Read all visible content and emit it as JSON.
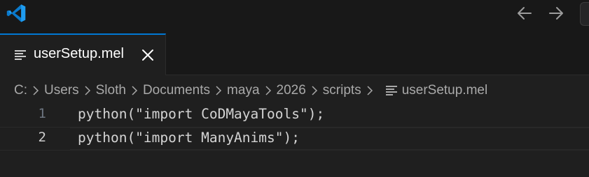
{
  "window": {
    "app_icon": "vscode-logo",
    "nav_back_icon": "arrow-left-icon",
    "nav_forward_icon": "arrow-right-icon"
  },
  "tab": {
    "label": "userSetup.mel",
    "icon": "file-lines-icon",
    "close_icon": "close-icon",
    "accent": "#0078d4"
  },
  "breadcrumb": {
    "items": [
      "C:",
      "Users",
      "Sloth",
      "Documents",
      "maya",
      "2026",
      "scripts",
      "userSetup.mel"
    ]
  },
  "editor": {
    "lines": [
      {
        "number": "1",
        "text": "python(\"import CoDMayaTools\");"
      },
      {
        "number": "2",
        "text": "python(\"import ManyAnims\");"
      }
    ],
    "current_line": 2
  }
}
